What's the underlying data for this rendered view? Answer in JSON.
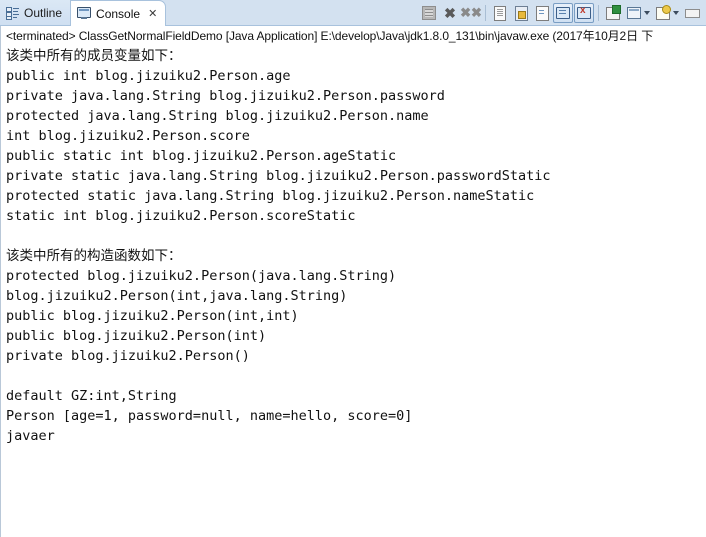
{
  "window": {
    "view_name": "Console"
  },
  "tabs": [
    {
      "label": "Outline",
      "icon": "outline-icon",
      "active": false,
      "closable": false
    },
    {
      "label": "Console",
      "icon": "console-icon",
      "active": true,
      "closable": true,
      "close_glyph": "✕"
    }
  ],
  "toolbar": {
    "buttons": [
      {
        "name": "terminate-button",
        "tooltip": "Terminate",
        "enabled": false
      },
      {
        "name": "remove-launch-button",
        "tooltip": "Remove Launch",
        "enabled": true
      },
      {
        "name": "remove-all-terminated-button",
        "tooltip": "Remove All Terminated Launches",
        "enabled": true
      },
      {
        "name": "clear-console-button",
        "tooltip": "Clear Console",
        "enabled": true
      },
      {
        "name": "scroll-lock-button",
        "tooltip": "Scroll Lock",
        "enabled": true
      },
      {
        "name": "word-wrap-button",
        "tooltip": "Word Wrap",
        "enabled": true
      },
      {
        "name": "show-console-on-output-button",
        "tooltip": "Show Console When Standard Out Changes",
        "pressed": true
      },
      {
        "name": "show-console-on-error-button",
        "tooltip": "Show Console When Standard Error Changes",
        "pressed": true
      },
      {
        "name": "pin-console-button",
        "tooltip": "Pin Console",
        "enabled": true
      },
      {
        "name": "display-selected-console-button",
        "tooltip": "Display Selected Console",
        "enabled": true
      },
      {
        "name": "open-console-button",
        "tooltip": "Open Console",
        "enabled": true
      },
      {
        "name": "view-menu-button",
        "tooltip": "View Menu",
        "enabled": true
      },
      {
        "name": "minimize-button",
        "tooltip": "Minimize",
        "enabled": true
      }
    ]
  },
  "console": {
    "terminated_line": "<terminated> ClassGetNormalFieldDemo [Java Application] E:\\develop\\Java\\jdk1.8.0_131\\bin\\javaw.exe (2017年10月2日 下",
    "output_lines": [
      "该类中所有的成员变量如下：",
      "public int blog.jizuiku2.Person.age",
      "private java.lang.String blog.jizuiku2.Person.password",
      "protected java.lang.String blog.jizuiku2.Person.name",
      "int blog.jizuiku2.Person.score",
      "public static int blog.jizuiku2.Person.ageStatic",
      "private static java.lang.String blog.jizuiku2.Person.passwordStatic",
      "protected static java.lang.String blog.jizuiku2.Person.nameStatic",
      "static int blog.jizuiku2.Person.scoreStatic",
      "",
      "该类中所有的构造函数如下：",
      "protected blog.jizuiku2.Person(java.lang.String)",
      "blog.jizuiku2.Person(int,java.lang.String)",
      "public blog.jizuiku2.Person(int,int)",
      "public blog.jizuiku2.Person(int)",
      "private blog.jizuiku2.Person()",
      "",
      "default GZ:int,String",
      "Person [age=1, password=null, name=hello, score=0]",
      "javaer"
    ]
  },
  "colors": {
    "tab_bar_background": "#d3e1f0",
    "active_tab_background": "#ffffff",
    "console_background": "#ffffff",
    "text": "#111111",
    "border": "#a8c2dd"
  }
}
